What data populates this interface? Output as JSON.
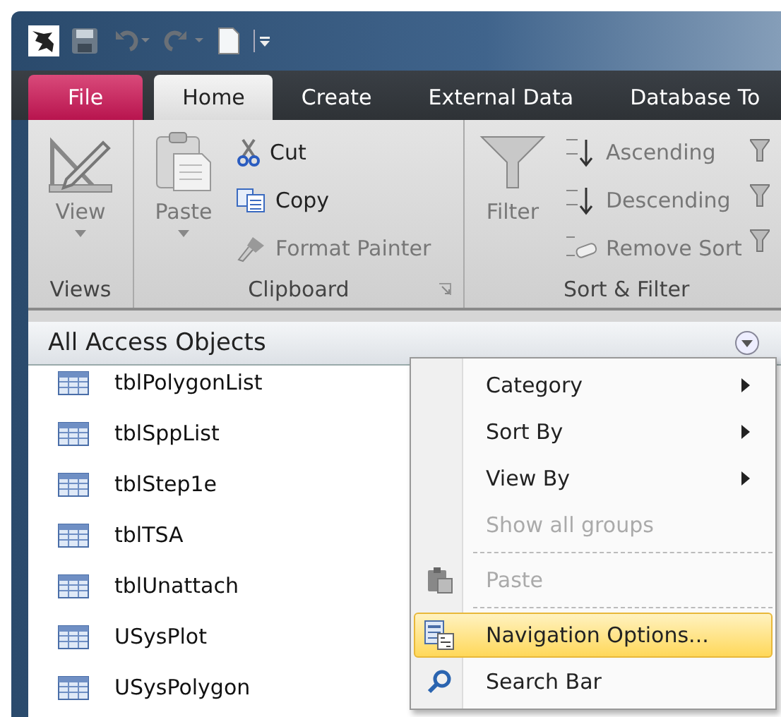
{
  "tabs": [
    {
      "label": "File",
      "kind": "file",
      "selected": false
    },
    {
      "label": "Home",
      "kind": "tab",
      "selected": true
    },
    {
      "label": "Create",
      "kind": "tab",
      "selected": false
    },
    {
      "label": "External Data",
      "kind": "tab",
      "selected": false
    },
    {
      "label": "Database To",
      "kind": "tab",
      "selected": false
    }
  ],
  "ribbon": {
    "views": {
      "label": "View",
      "group": "Views"
    },
    "clipboard": {
      "paste": "Paste",
      "cut": "Cut",
      "copy": "Copy",
      "format_painter": "Format Painter",
      "group": "Clipboard"
    },
    "sort_filter": {
      "filter": "Filter",
      "ascending": "Ascending",
      "descending": "Descending",
      "remove_sort": "Remove Sort",
      "group": "Sort & Filter"
    }
  },
  "nav_pane": {
    "title": "All Access Objects",
    "items": [
      "tblPolygonList",
      "tblSppList",
      "tblStep1e",
      "tblTSA",
      "tblUnattach",
      "USysPlot",
      "USysPolygon"
    ]
  },
  "context_menu": [
    {
      "label": "Category",
      "kind": "submenu",
      "disabled": false,
      "selected": false
    },
    {
      "label": "Sort By",
      "kind": "submenu",
      "disabled": false,
      "selected": false
    },
    {
      "label": "View By",
      "kind": "submenu",
      "disabled": false,
      "selected": false
    },
    {
      "label": "Show all groups",
      "kind": "item",
      "disabled": true,
      "selected": false
    },
    {
      "kind": "separator"
    },
    {
      "label": "Paste",
      "kind": "paste",
      "disabled": true,
      "selected": false
    },
    {
      "kind": "separator"
    },
    {
      "label": "Navigation Options...",
      "kind": "options",
      "disabled": false,
      "selected": true
    },
    {
      "label": "Search Bar",
      "kind": "search",
      "disabled": false,
      "selected": false
    }
  ]
}
